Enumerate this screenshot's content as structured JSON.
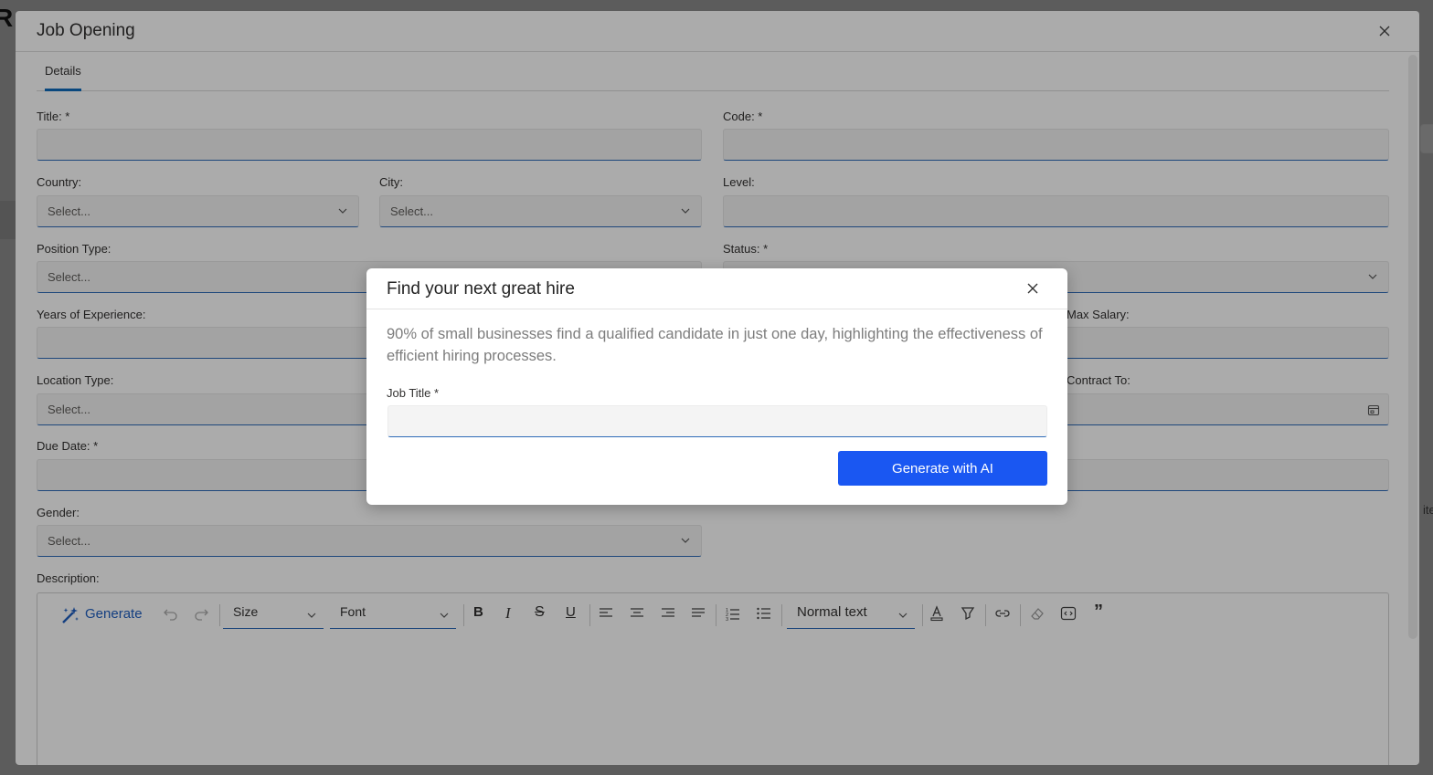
{
  "background": {
    "letter": "R",
    "right_text": "ite"
  },
  "dialog": {
    "title": "Job Opening",
    "tabs": [
      {
        "label": "Details"
      }
    ],
    "fields": {
      "title": {
        "label": "Title: *",
        "value": ""
      },
      "code": {
        "label": "Code: *",
        "value": ""
      },
      "country": {
        "label": "Country:",
        "placeholder": "Select..."
      },
      "city": {
        "label": "City:",
        "placeholder": "Select..."
      },
      "level": {
        "label": "Level:",
        "value": ""
      },
      "position_type": {
        "label": "Position Type:",
        "placeholder": "Select..."
      },
      "status": {
        "label": "Status: *",
        "value": ""
      },
      "years_experience": {
        "label": "Years of Experience:",
        "value": ""
      },
      "max_salary": {
        "label": "Max Salary:",
        "value": ""
      },
      "location_type": {
        "label": "Location Type:",
        "placeholder": "Select..."
      },
      "contract_to": {
        "label": "Contract To:",
        "value": ""
      },
      "due_date": {
        "label": "Due Date: *",
        "value": ""
      },
      "gender": {
        "label": "Gender:",
        "placeholder": "Select..."
      },
      "description": {
        "label": "Description:"
      }
    },
    "editor_toolbar": {
      "generate_label": "Generate",
      "size_label": "Size",
      "font_label": "Font",
      "block_label": "Normal text",
      "buttons": [
        "undo-icon",
        "redo-icon",
        "bold-icon",
        "italic-icon",
        "strikethrough-icon",
        "underline-icon",
        "align-left-icon",
        "align-center-icon",
        "align-right-icon",
        "align-justify-icon",
        "numbered-list-icon",
        "bullet-list-icon",
        "text-color-icon",
        "highlight-icon",
        "link-icon",
        "clear-format-icon",
        "code-icon",
        "quote-icon"
      ]
    }
  },
  "popup": {
    "title": "Find your next great hire",
    "description": "90% of small businesses find a qualified candidate in just one day, highlighting the effectiveness of efficient hiring processes.",
    "job_title_label": "Job Title *",
    "job_title_value": "",
    "generate_button": "Generate with AI"
  },
  "colors": {
    "accent": "#1a57f2",
    "field_underline": "#2e6bb8",
    "tab_indicator": "#0f6cbd"
  }
}
